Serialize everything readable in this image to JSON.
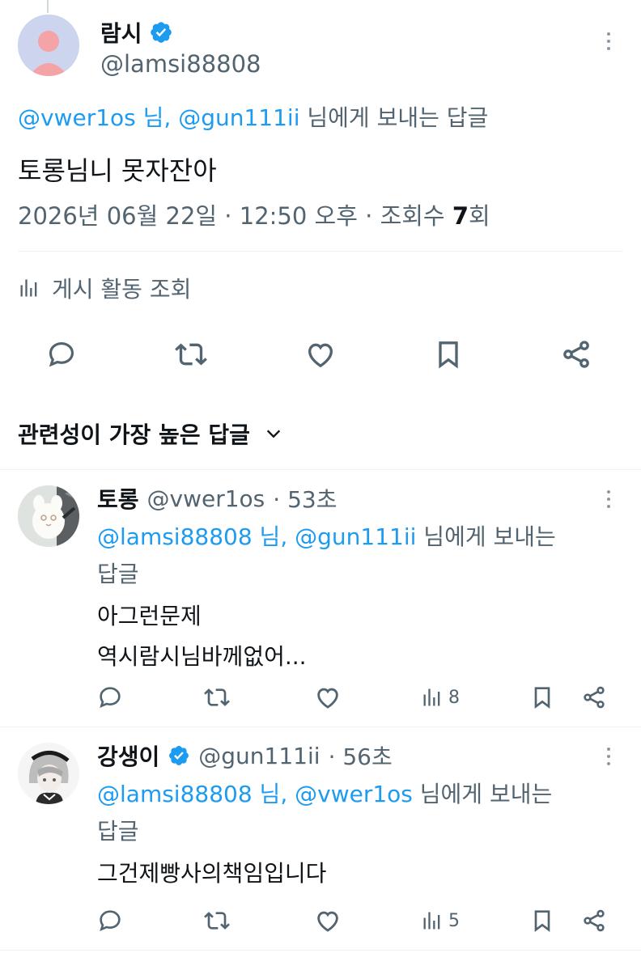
{
  "main_post": {
    "display_name": "람시",
    "handle": "@lamsi88808",
    "reply_to": {
      "mention1": "@vwer1os",
      "sep1": " 님, ",
      "mention2": "@gun111ii",
      "suffix": " 님에게 보내는 답글"
    },
    "text": "토롱님니 못자잔아",
    "meta": {
      "date": "2026년 06월 22일",
      "dot1": " · ",
      "time": "12:50 오후",
      "dot2": " · ",
      "views_label": "조회수 ",
      "views_count": "7",
      "views_unit": "회"
    },
    "activity_label": "게시 활동 조회"
  },
  "sort": {
    "label": "관련성이 가장 높은 답글"
  },
  "replies": [
    {
      "display_name": "토롱",
      "handle": "@vwer1os",
      "time": "· 53초",
      "reply_to": {
        "mention1": "@lamsi88808",
        "sep1": " 님, ",
        "mention2": "@gun111ii",
        "suffix": " 님에게 보내는",
        "suffix2": "답글"
      },
      "lines": [
        "아그런문제",
        "역시람시님바께없어..."
      ],
      "views": "8"
    },
    {
      "display_name": "강생이",
      "handle": "@gun111ii",
      "time": "· 56초",
      "reply_to": {
        "mention1": "@lamsi88808",
        "sep1": " 님, ",
        "mention2": "@vwer1os",
        "suffix": " 님에게 보내는",
        "suffix2": "답글"
      },
      "lines": [
        "그건제빵사의책임입니다"
      ],
      "views": "5"
    }
  ],
  "colors": {
    "accent": "#1d9bf0",
    "secondary_text": "#536471",
    "divider": "#eff3f4"
  },
  "icons": [
    "verified-badge-icon",
    "more-icon",
    "chart-bars-icon",
    "reply-icon",
    "retweet-icon",
    "like-icon",
    "bookmark-icon",
    "share-icon",
    "chevron-down-icon"
  ]
}
